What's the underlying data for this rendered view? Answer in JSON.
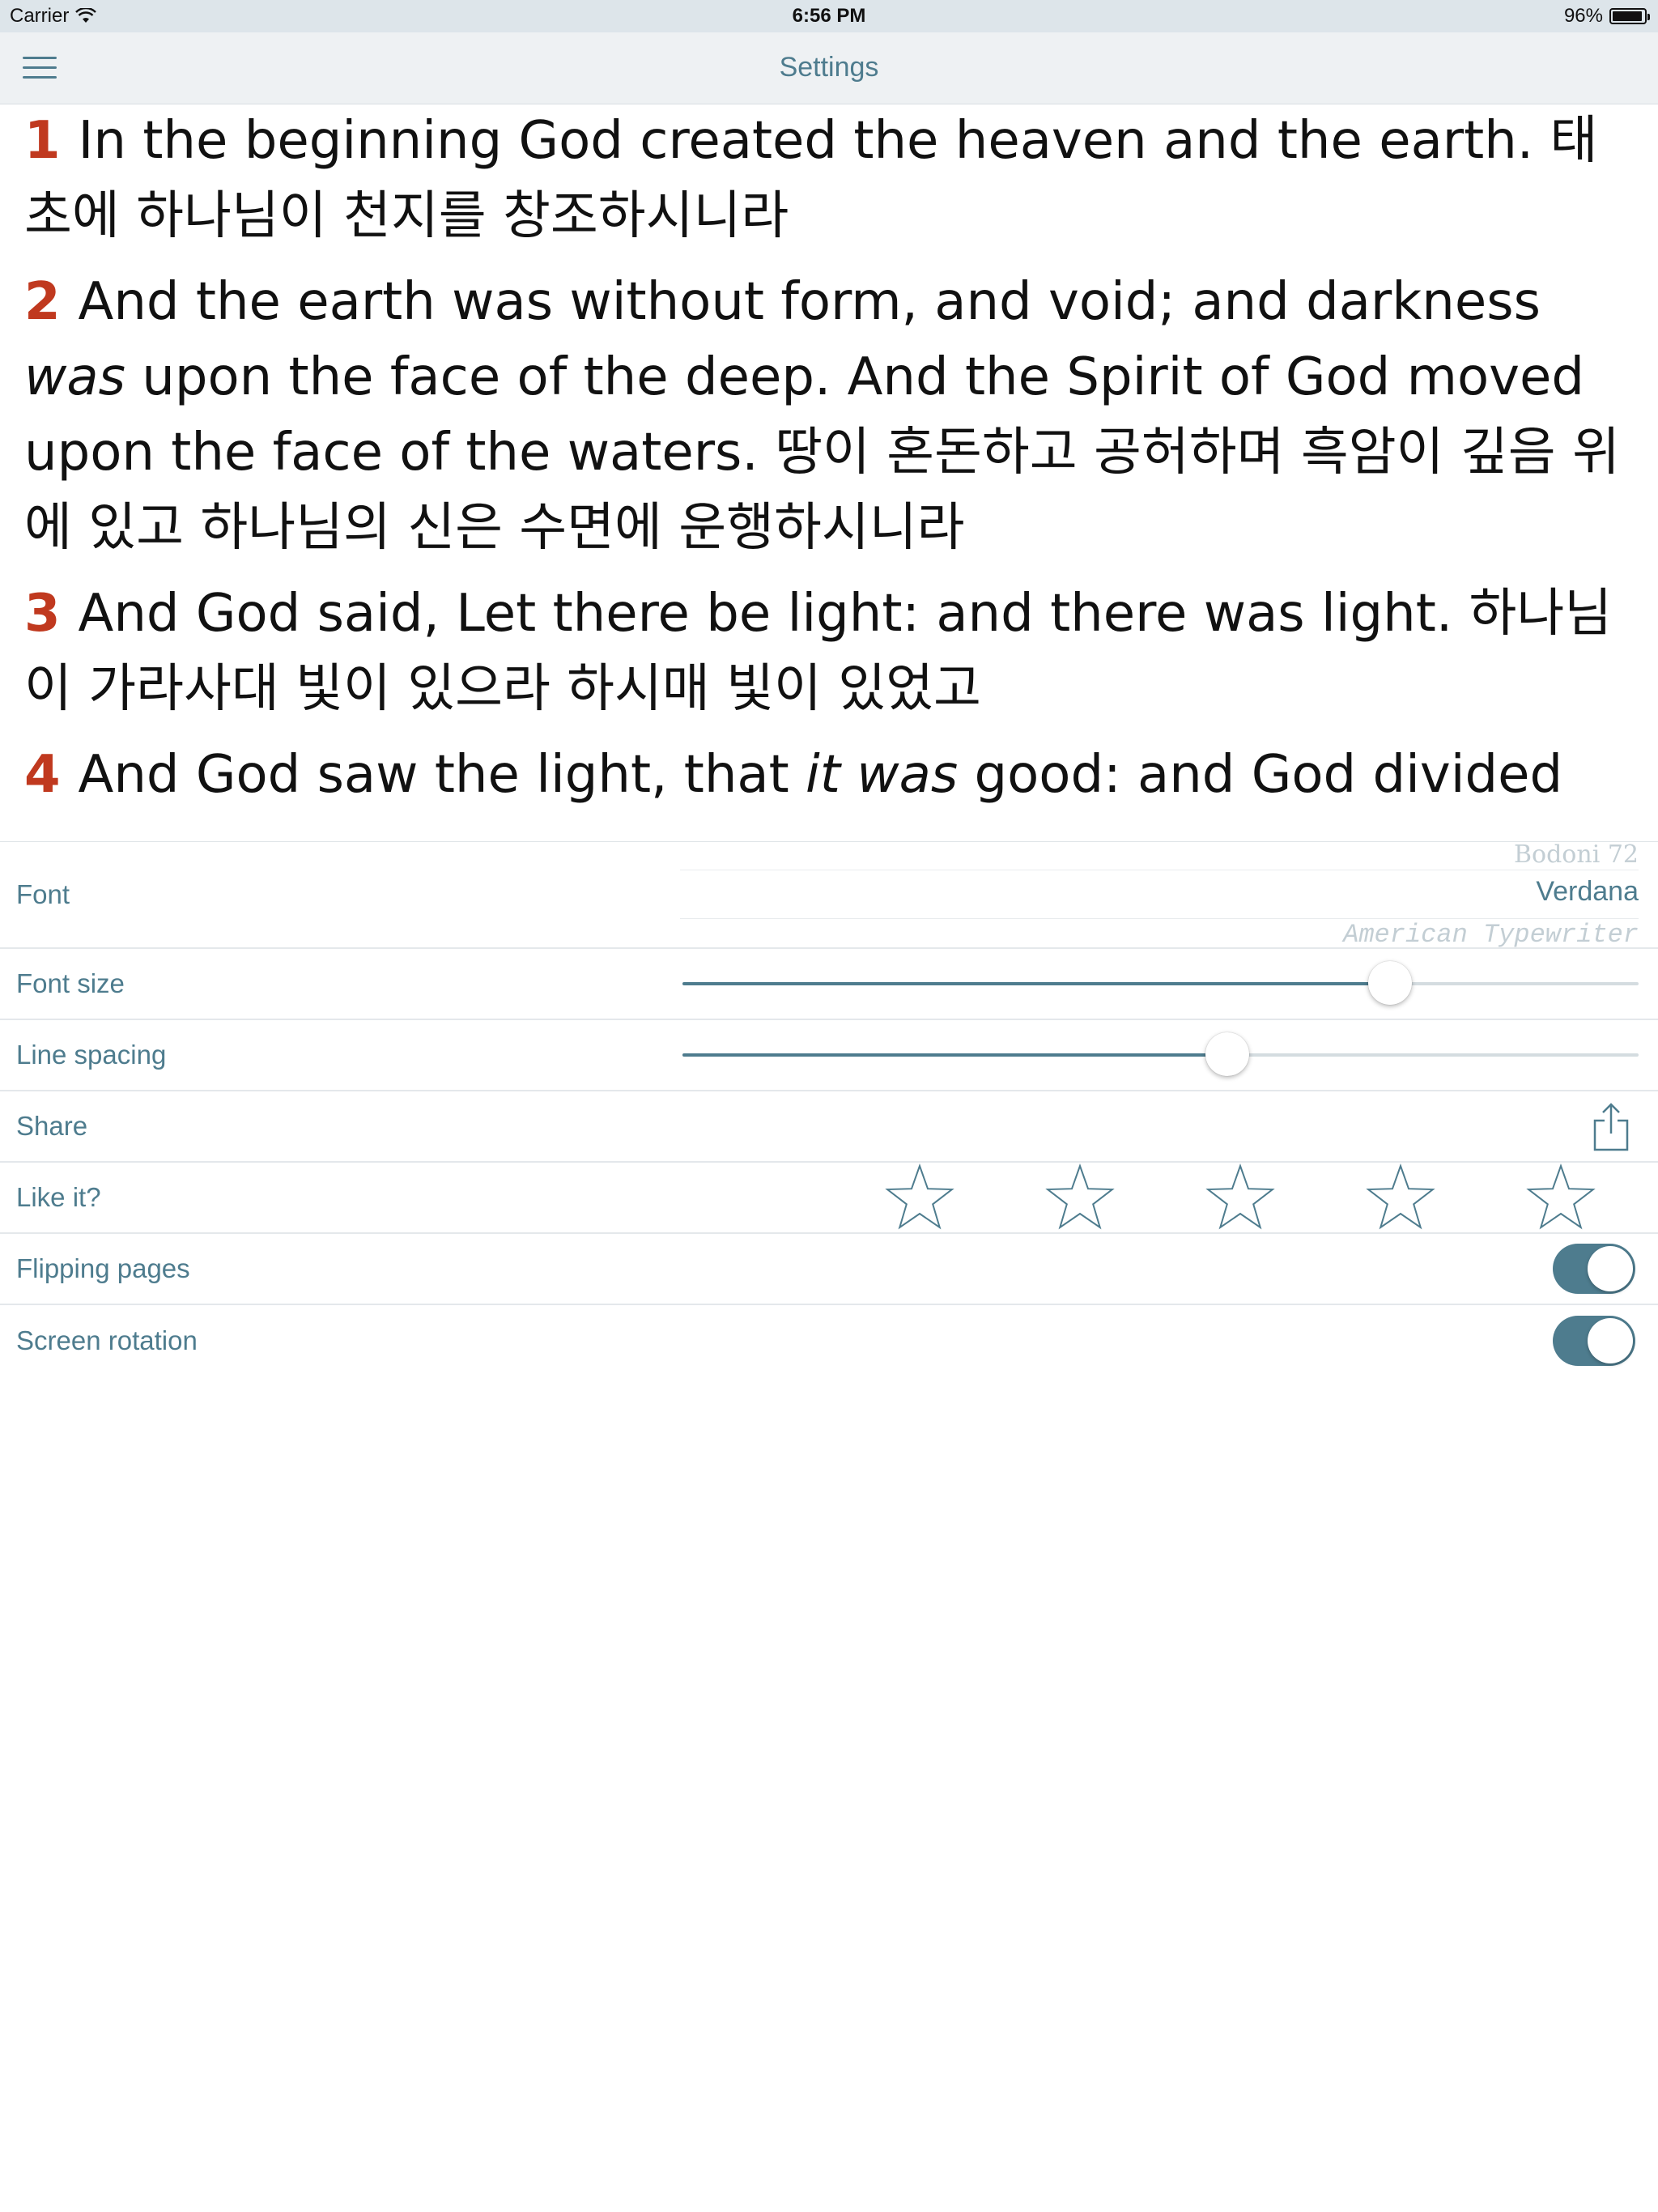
{
  "status_bar": {
    "carrier": "Carrier",
    "time": "6:56 PM",
    "battery_text": "96%",
    "battery_level": 0.96
  },
  "nav": {
    "title": "Settings",
    "menu_icon": "hamburger-menu-icon"
  },
  "verses": [
    {
      "num": "1",
      "parts": [
        {
          "t": "In the beginning God created the heaven and the earth. "
        }
      ],
      "ko": "태초에 하나님이 천지를 창조하시니라"
    },
    {
      "num": "2",
      "parts": [
        {
          "t": "And the earth was without form, and void; and darkness "
        },
        {
          "t": "was",
          "i": true
        },
        {
          "t": " upon the face of the deep. And the Spirit of God moved upon the face of the waters.  "
        }
      ],
      "ko": "땅이 혼돈하고 공허하며 흑암이 깊음 위에 있고 하나님의 신은 수면에 운행하시니라"
    },
    {
      "num": "3",
      "parts": [
        {
          "t": "And God said, Let there be light: and there was light.  "
        }
      ],
      "ko": "하나님이 가라사대 빛이 있으라 하시매 빛이 있었고"
    },
    {
      "num": "4",
      "parts": [
        {
          "t": "And God saw the light, that "
        },
        {
          "t": "it was",
          "i": true
        },
        {
          "t": " good: and God divided"
        }
      ],
      "ko": ""
    }
  ],
  "settings": {
    "font_label": "Font",
    "font_options": {
      "prev": "Bodoni 72",
      "selected": "Verdana",
      "next": "American Typewriter"
    },
    "font_size_label": "Font size",
    "font_size_value": 0.74,
    "line_spacing_label": "Line spacing",
    "line_spacing_value": 0.57,
    "share_label": "Share",
    "share_icon": "share-icon",
    "like_label": "Like it?",
    "rating": {
      "max": 5,
      "value": 0,
      "icon": "star-outline-icon"
    },
    "flipping_label": "Flipping pages",
    "flipping_on": true,
    "rotation_label": "Screen rotation",
    "rotation_on": true
  },
  "colors": {
    "accent": "#4e7c8e",
    "verse_number": "#c0391f",
    "status_bar_bg": "#dde5ea",
    "nav_bg": "#eef1f3"
  }
}
